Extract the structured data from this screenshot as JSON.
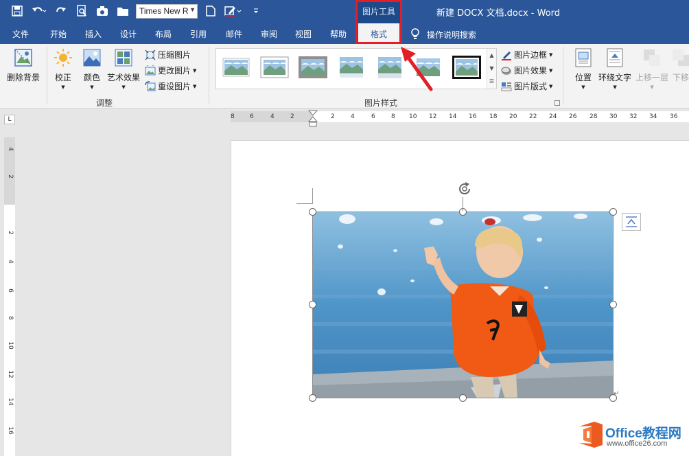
{
  "qat": {
    "font_name": "Times New R",
    "icons": [
      "save-icon",
      "undo-icon",
      "redo-icon",
      "print-preview-icon",
      "camera-icon",
      "folder-icon",
      "new-doc-icon",
      "draw-icon",
      "customize-icon"
    ]
  },
  "title_bar": {
    "context_group": "图片工具",
    "document_title": "新建 DOCX 文档.docx  -  Word"
  },
  "tabs": {
    "items": [
      "文件",
      "开始",
      "插入",
      "设计",
      "布局",
      "引用",
      "邮件",
      "审阅",
      "视图",
      "帮助"
    ],
    "active": "格式",
    "tell_me": "操作说明搜索"
  },
  "ribbon": {
    "remove_bg": "删除背景",
    "corrections": "校正",
    "color": "颜色",
    "artistic": "艺术效果",
    "compress": "压缩图片",
    "change": "更改图片",
    "reset": "重设图片",
    "group_adjust": "调整",
    "group_styles": "图片样式",
    "border": "图片边框",
    "effects": "图片效果",
    "layout": "图片版式",
    "position": "位置",
    "wrap_text": "环绕文字",
    "bring_forward": "上移一层",
    "send_backward": "下移"
  },
  "ruler": {
    "corner": "L",
    "h_numbers": [
      "8",
      "6",
      "4",
      "2",
      "2",
      "4",
      "6",
      "8",
      "10",
      "12",
      "14",
      "16",
      "18",
      "20",
      "22",
      "24",
      "26",
      "28",
      "30",
      "32",
      "34",
      "36"
    ],
    "v_numbers": [
      "4",
      "2",
      "2",
      "4",
      "6",
      "8",
      "10",
      "12",
      "14",
      "16"
    ]
  },
  "watermark": {
    "title": "Office教程网",
    "url": "www.office26.com"
  },
  "colors": {
    "word_blue": "#2b579a",
    "highlight_red": "#e41e26"
  }
}
